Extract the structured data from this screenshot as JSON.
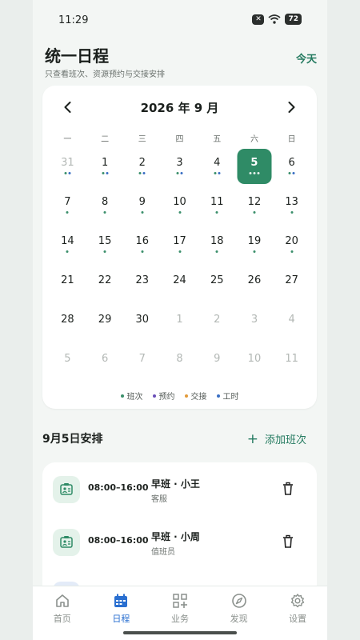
{
  "status_bar": {
    "time": "11:29",
    "battery": "72",
    "x_glyph": "✕"
  },
  "header": {
    "title": "统一日程",
    "subtitle": "只查看班次、资源预约与交接安排",
    "today_label": "今天"
  },
  "calendar": {
    "title": "2026 年 9 月",
    "weekdays": [
      "一",
      "二",
      "三",
      "四",
      "五",
      "六",
      "日"
    ],
    "selected_day": "5",
    "weeks": [
      [
        {
          "num": "31",
          "muted": true,
          "dots": [
            "green",
            "blue"
          ]
        },
        {
          "num": "1",
          "dots": [
            "green",
            "blue"
          ]
        },
        {
          "num": "2",
          "dots": [
            "green",
            "blue"
          ]
        },
        {
          "num": "3",
          "dots": [
            "green",
            "blue"
          ]
        },
        {
          "num": "4",
          "dots": [
            "green",
            "blue"
          ]
        },
        {
          "num": "5",
          "selected": true,
          "dots": [
            "white",
            "white",
            "white"
          ]
        },
        {
          "num": "6",
          "dots": [
            "green",
            "blue"
          ]
        }
      ],
      [
        {
          "num": "7",
          "dots": [
            "green"
          ]
        },
        {
          "num": "8",
          "dots": [
            "green"
          ]
        },
        {
          "num": "9",
          "dots": [
            "green"
          ]
        },
        {
          "num": "10",
          "dots": [
            "green"
          ]
        },
        {
          "num": "11",
          "dots": [
            "green"
          ]
        },
        {
          "num": "12",
          "dots": [
            "green"
          ]
        },
        {
          "num": "13",
          "dots": [
            "green"
          ]
        }
      ],
      [
        {
          "num": "14",
          "dots": [
            "green"
          ]
        },
        {
          "num": "15",
          "dots": [
            "green"
          ]
        },
        {
          "num": "16",
          "dots": [
            "green"
          ]
        },
        {
          "num": "17",
          "dots": [
            "green"
          ]
        },
        {
          "num": "18",
          "dots": [
            "green"
          ]
        },
        {
          "num": "19",
          "dots": [
            "green"
          ]
        },
        {
          "num": "20",
          "dots": [
            "green"
          ]
        }
      ],
      [
        {
          "num": "21",
          "dots": []
        },
        {
          "num": "22",
          "dots": []
        },
        {
          "num": "23",
          "dots": []
        },
        {
          "num": "24",
          "dots": []
        },
        {
          "num": "25",
          "dots": []
        },
        {
          "num": "26",
          "dots": []
        },
        {
          "num": "27",
          "dots": []
        }
      ],
      [
        {
          "num": "28",
          "dots": []
        },
        {
          "num": "29",
          "dots": []
        },
        {
          "num": "30",
          "dots": []
        },
        {
          "num": "1",
          "muted": true,
          "dots": []
        },
        {
          "num": "2",
          "muted": true,
          "dots": []
        },
        {
          "num": "3",
          "muted": true,
          "dots": []
        },
        {
          "num": "4",
          "muted": true,
          "dots": []
        }
      ],
      [
        {
          "num": "5",
          "muted": true,
          "dots": []
        },
        {
          "num": "6",
          "muted": true,
          "dots": []
        },
        {
          "num": "7",
          "muted": true,
          "dots": []
        },
        {
          "num": "8",
          "muted": true,
          "dots": []
        },
        {
          "num": "9",
          "muted": true,
          "dots": []
        },
        {
          "num": "10",
          "muted": true,
          "dots": []
        },
        {
          "num": "11",
          "muted": true,
          "dots": []
        }
      ]
    ],
    "legend": [
      {
        "label": "班次",
        "color": "#3b8f6b"
      },
      {
        "label": "预约",
        "color": "#6a4fb8"
      },
      {
        "label": "交接",
        "color": "#e29a3a"
      },
      {
        "label": "工时",
        "color": "#3a6fc4"
      }
    ]
  },
  "colors": {
    "accent": "#237a5f",
    "selected_day_bg": "#2f8b66",
    "dot_green": "#3b8f6b",
    "dot_blue": "#3a6fc4",
    "dot_white": "#ffffff",
    "tab_active": "#2a6fd0"
  },
  "schedule": {
    "section_title": "9月5日安排",
    "add_label": "添加班次",
    "items": [
      {
        "time": "08:00–16:00",
        "name": "早班 · 小王",
        "role": "客服",
        "icon": "badge-icon"
      },
      {
        "time": "08:00–16:00",
        "name": "早班 · 小周",
        "role": "值班员",
        "icon": "badge-icon"
      }
    ]
  },
  "tabs": [
    {
      "label": "首页",
      "icon": "home-icon"
    },
    {
      "label": "日程",
      "icon": "calendar-icon",
      "active": true
    },
    {
      "label": "业务",
      "icon": "grid-plus-icon"
    },
    {
      "label": "发现",
      "icon": "compass-icon"
    },
    {
      "label": "设置",
      "icon": "gear-icon"
    }
  ]
}
